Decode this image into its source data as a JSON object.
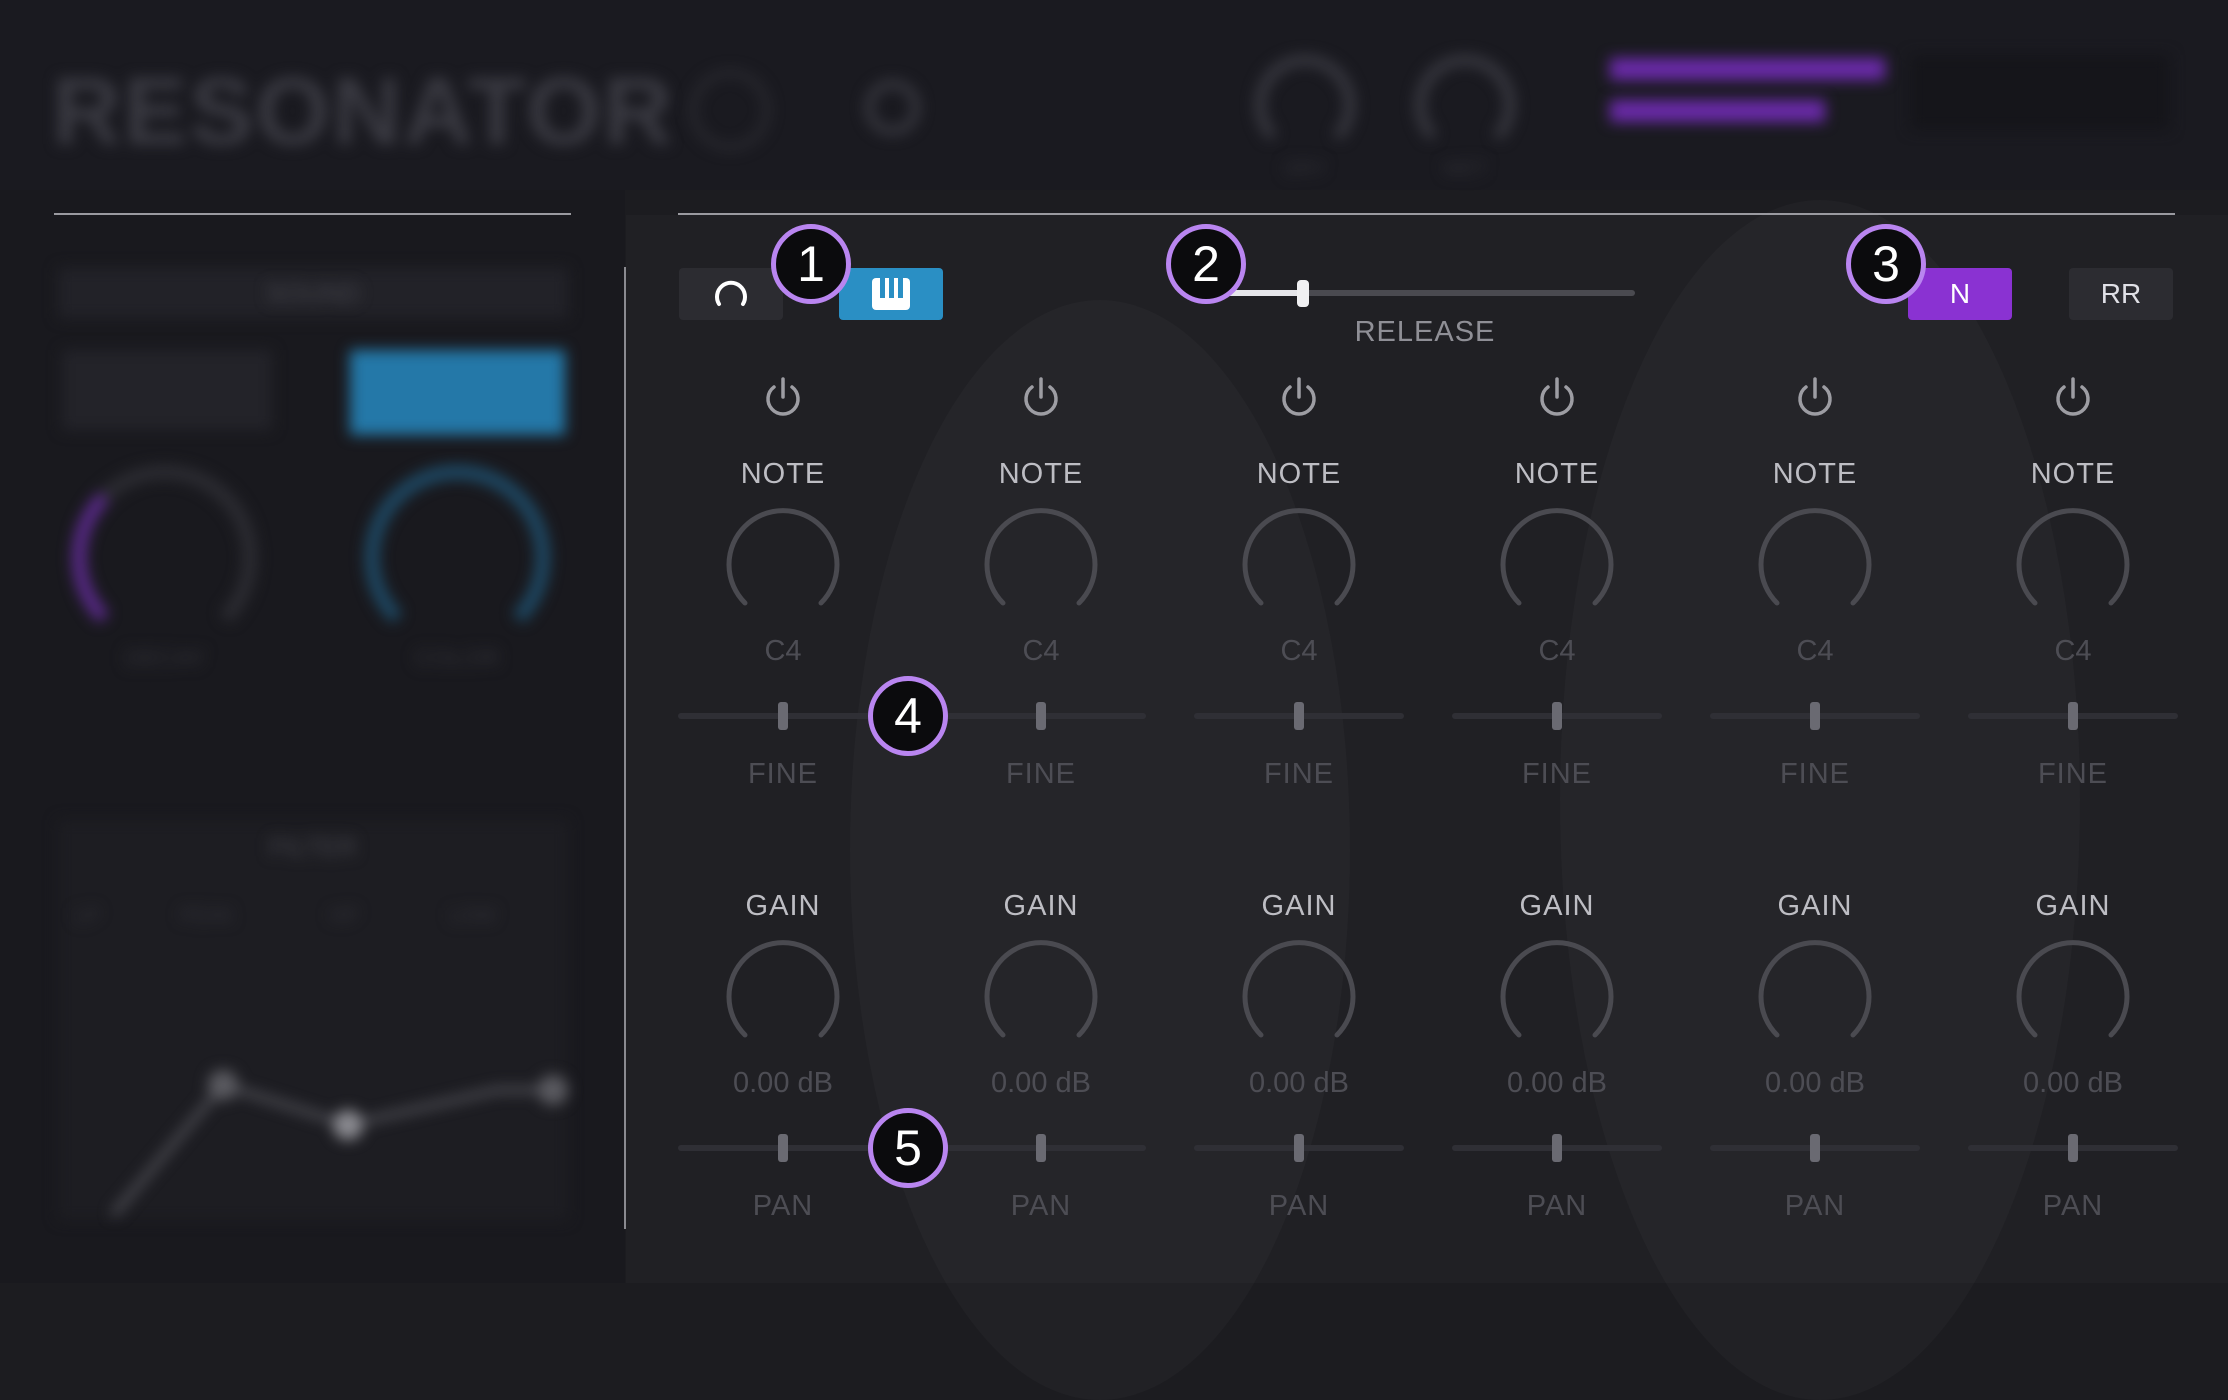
{
  "header": {
    "logo_text": "RESONATOR",
    "knob1_label": "DRY",
    "knob2_label": "WET"
  },
  "left_panel": {
    "title": "SOUND",
    "knob1_label": "DECAY",
    "knob2_label": "COLOR",
    "filter_title": "FILTER",
    "filter_tabs": [
      "LP",
      "PEAK",
      "HP",
      "LOW"
    ]
  },
  "toolbar": {
    "release_label": "RELEASE",
    "release_value": 0.21,
    "mode_n_label": "N",
    "mode_rr_label": "RR"
  },
  "voices": [
    {
      "note_label": "NOTE",
      "note_value": "C4",
      "fine_label": "FINE",
      "gain_label": "GAIN",
      "gain_value": "0.00 dB",
      "pan_label": "PAN"
    },
    {
      "note_label": "NOTE",
      "note_value": "C4",
      "fine_label": "FINE",
      "gain_label": "GAIN",
      "gain_value": "0.00 dB",
      "pan_label": "PAN"
    },
    {
      "note_label": "NOTE",
      "note_value": "C4",
      "fine_label": "FINE",
      "gain_label": "GAIN",
      "gain_value": "0.00 dB",
      "pan_label": "PAN"
    },
    {
      "note_label": "NOTE",
      "note_value": "C4",
      "fine_label": "FINE",
      "gain_label": "GAIN",
      "gain_value": "0.00 dB",
      "pan_label": "PAN"
    },
    {
      "note_label": "NOTE",
      "note_value": "C4",
      "fine_label": "FINE",
      "gain_label": "GAIN",
      "gain_value": "0.00 dB",
      "pan_label": "PAN"
    },
    {
      "note_label": "NOTE",
      "note_value": "C4",
      "fine_label": "FINE",
      "gain_label": "GAIN",
      "gain_value": "0.00 dB",
      "pan_label": "PAN"
    }
  ],
  "callouts": [
    "1",
    "2",
    "3",
    "4",
    "5"
  ],
  "colors": {
    "accent_purple": "#8a32d2",
    "accent_blue": "#2a8fc4",
    "callout_ring": "#b985f0"
  },
  "icons": {
    "loop": "loop-icon",
    "keys": "piano-keys-icon",
    "power": "power-icon"
  }
}
